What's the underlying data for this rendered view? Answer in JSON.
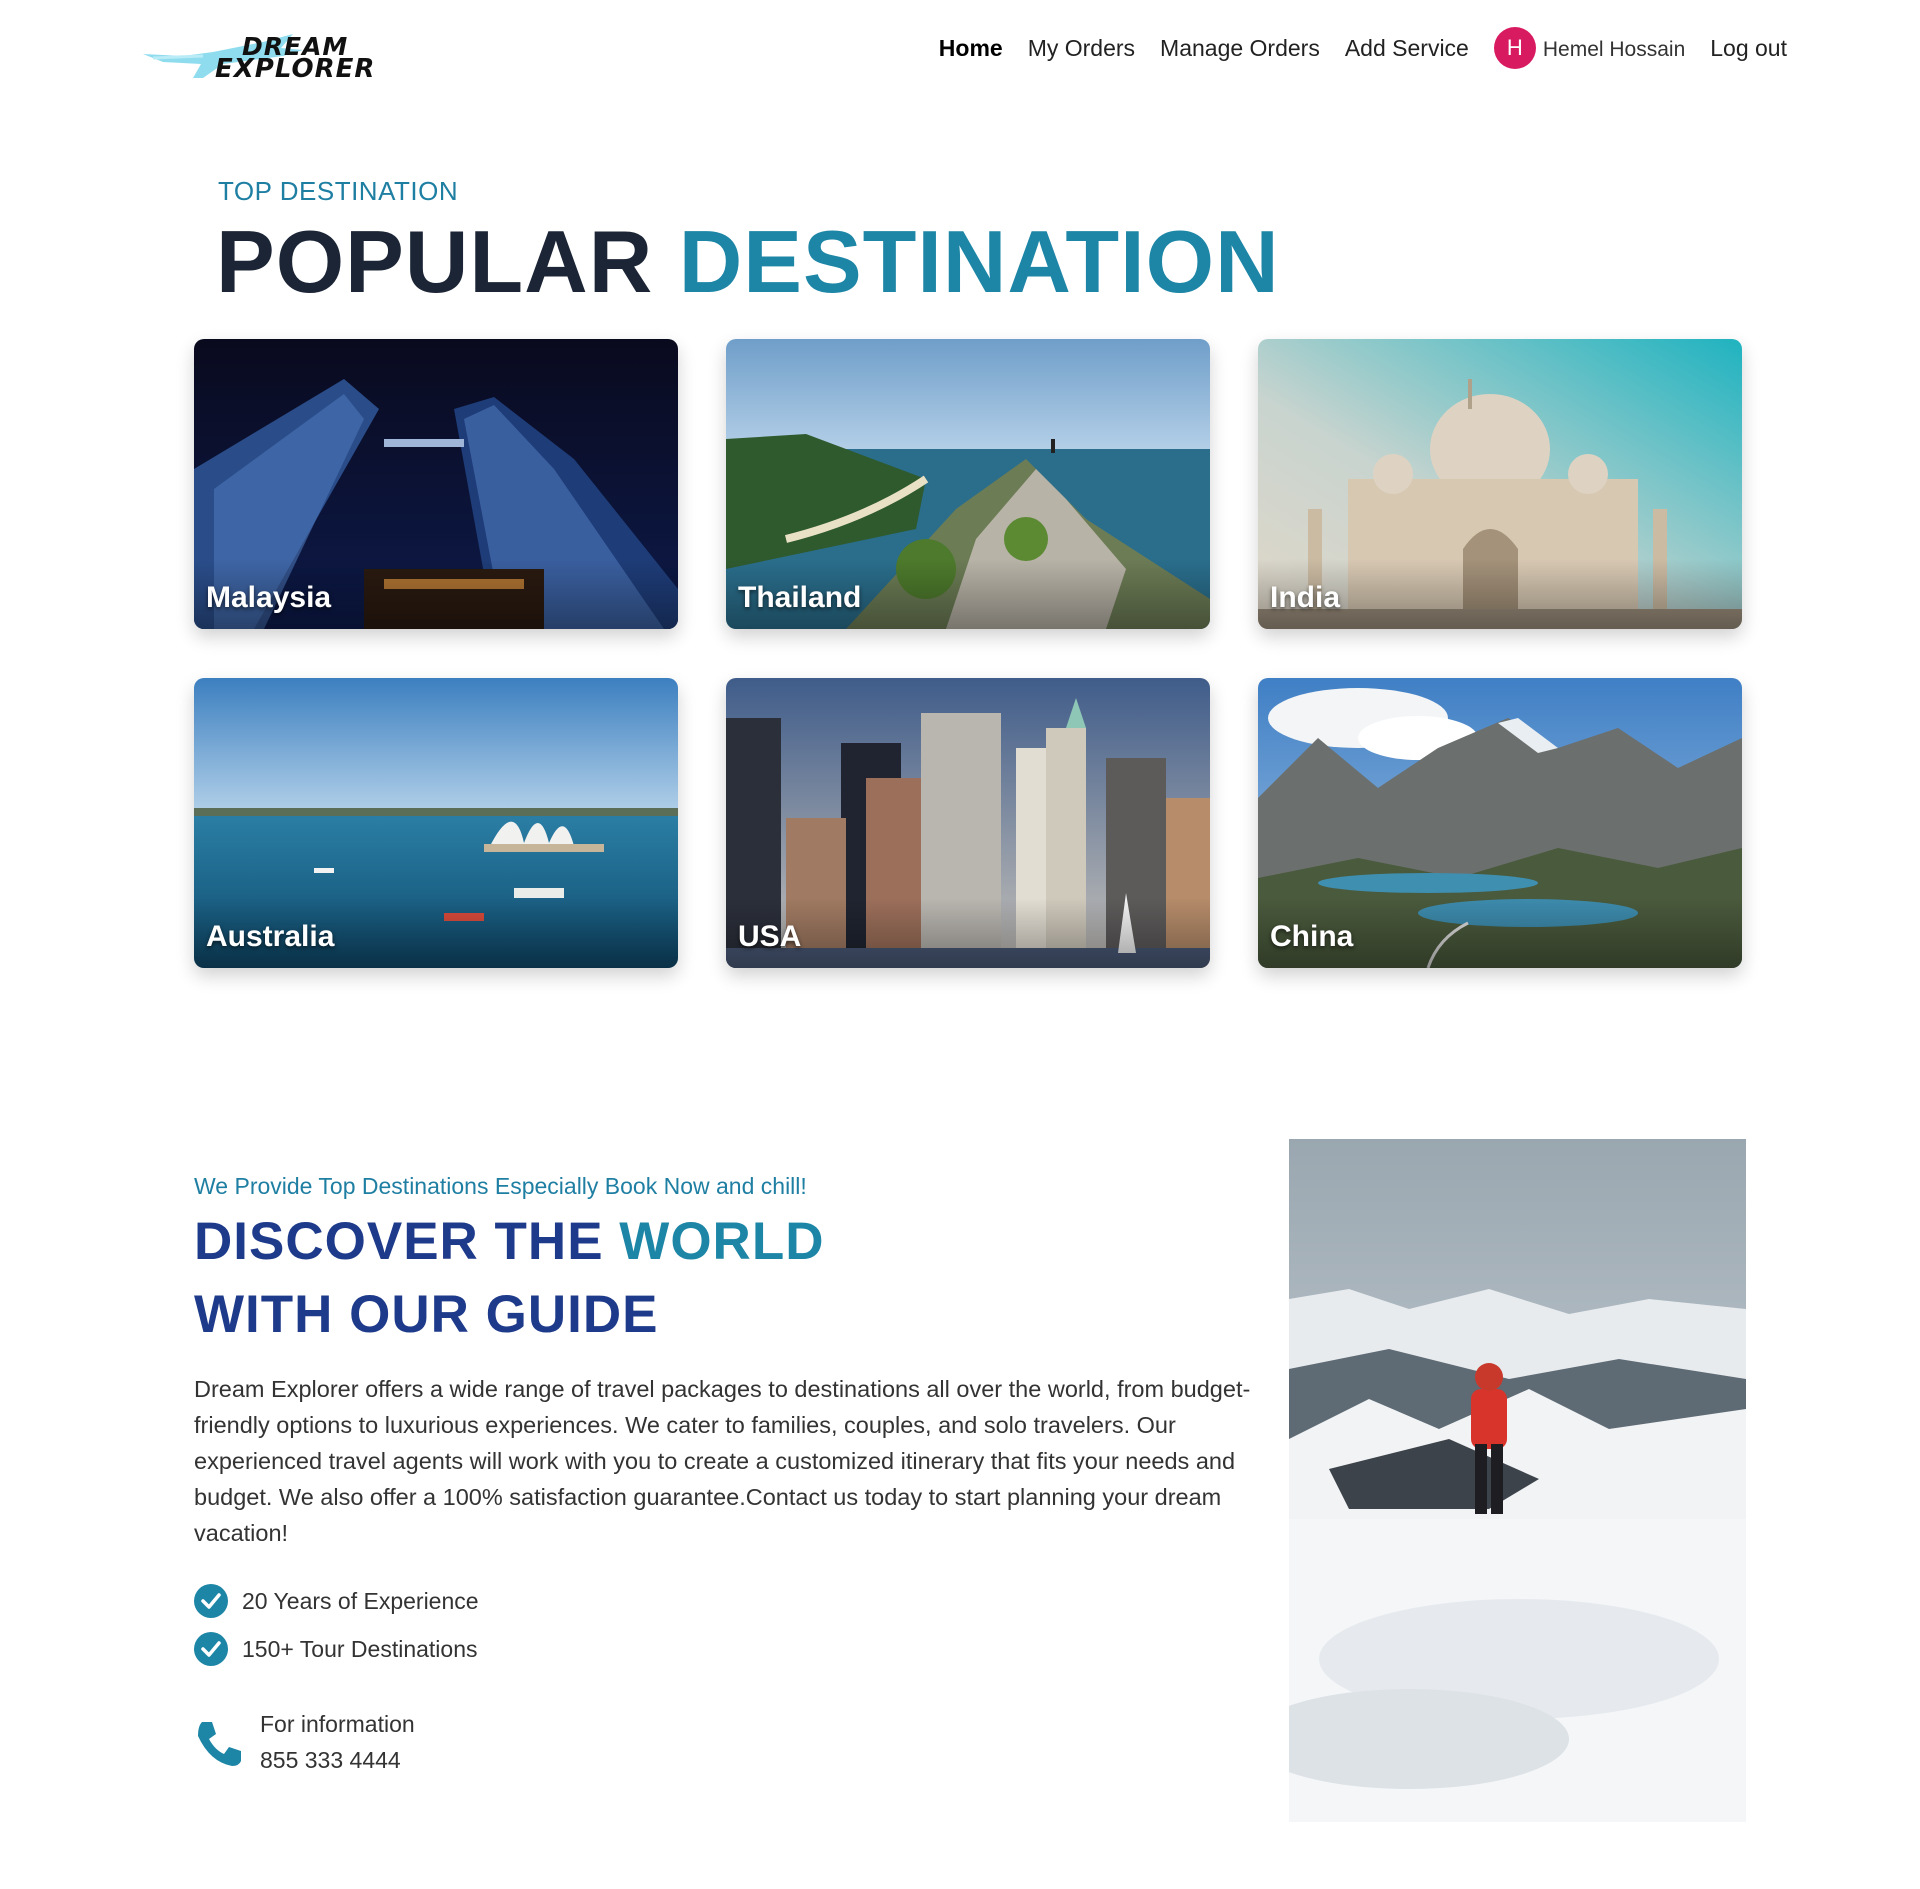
{
  "nav": {
    "brand_line1": "DREAM",
    "brand_line2": "EXPLORER",
    "home": "Home",
    "my_orders": "My Orders",
    "manage_orders": "Manage Orders",
    "add_service": "Add Service",
    "user_initial": "H",
    "user_name": "Hemel Hossain",
    "logout": "Log out"
  },
  "popular": {
    "subtitle": "TOP DESTINATION",
    "title_dark": "POPULAR",
    "title_blue": "DESTINATION",
    "destinations": [
      {
        "label": "Malaysia"
      },
      {
        "label": "Thailand"
      },
      {
        "label": "India"
      },
      {
        "label": "Australia"
      },
      {
        "label": "USA"
      },
      {
        "label": "China"
      }
    ]
  },
  "discover": {
    "tagline": "We Provide Top Destinations Especially Book Now and chill!",
    "title_line1_dark": "DISCOVER THE",
    "title_line1_blue": "WORLD",
    "title_line2": "WITH OUR GUIDE",
    "description": "Dream Explorer offers a wide range of travel packages to destinations all over the world, from budget-friendly options to luxurious experiences. We cater to families, couples, and solo travelers. Our experienced travel agents will work with you to create a customized itinerary that fits your needs and budget. We also offer a 100% satisfaction guarantee.Contact us today to start planning your dream vacation!",
    "features": [
      "20 Years of Experience",
      "150+ Tour Destinations"
    ],
    "info_label": "For information",
    "phone": "855 333 4444"
  },
  "colors": {
    "accent": "#1d86a6",
    "navy": "#1e3a8a",
    "avatar": "#d81b60"
  },
  "icons": [
    "airplane-logo-icon",
    "check-circle-icon",
    "phone-icon"
  ]
}
